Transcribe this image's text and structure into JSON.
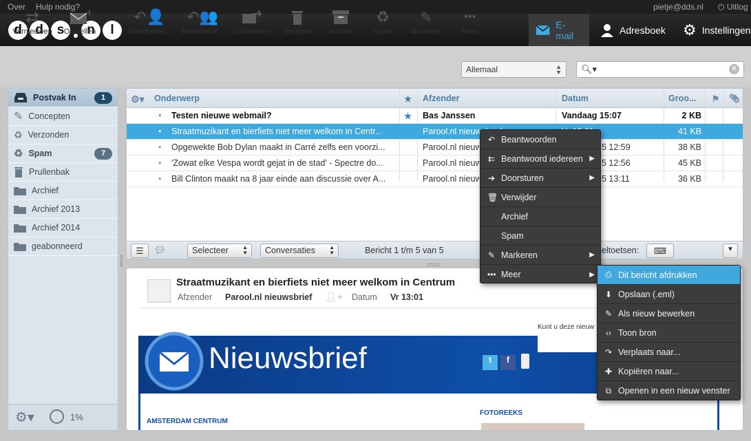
{
  "topstrip": {
    "about": "Over",
    "help": "Hulp nodig?",
    "user": "pietje@dds.nl",
    "logout": "Uitlog"
  },
  "logo": {
    "letters": [
      "d",
      "d",
      "s",
      "n",
      "l"
    ]
  },
  "nav": {
    "email": "E-mail",
    "contacts": "Adresboek",
    "settings": "Instellingen"
  },
  "toolbar": {
    "refresh": "Vernieuwen",
    "compose": "Opstellen",
    "reply": "Beantwoor...",
    "reply_all": "Beantwoor...",
    "forward": "Doorsturen",
    "delete": "Verwijder",
    "archive": "Archief",
    "spam": "Spam",
    "mark": "Markeren",
    "more": "Meer",
    "filter_value": "Allemaal",
    "search_placeholder": ""
  },
  "sidebar": {
    "folders": [
      {
        "label": "Postvak In",
        "count": "1"
      },
      {
        "label": "Concepten"
      },
      {
        "label": "Verzonden"
      },
      {
        "label": "Spam",
        "count": "7"
      },
      {
        "label": "Prullenbak"
      },
      {
        "label": "Archief"
      },
      {
        "label": "Archief 2013"
      },
      {
        "label": "Archief 2014"
      },
      {
        "label": "geabonneerd"
      }
    ],
    "quota": "1%"
  },
  "list": {
    "columns": {
      "subject": "Onderwerp",
      "from": "Afzender",
      "date": "Datum",
      "size": "Groo..."
    },
    "rows": [
      {
        "subject": "Testen nieuwe webmail?",
        "from": "Bas Janssen",
        "date": "Vandaag 15:07",
        "size": "2 KB"
      },
      {
        "subject": "Straatmuzikant en bierfiets niet meer welkom in Centr...",
        "from": "Parool.nl nieuwsbrief",
        "date": "Vr 13:01",
        "size": "41 KB"
      },
      {
        "subject": "Opgewekte Bob Dylan maakt in Carré zelfs een voorzi...",
        "from": "Parool.nl nieuwsbrief",
        "date": "5 12:59",
        "size": "38 KB"
      },
      {
        "subject": "'Zowat elke Vespa wordt gejat in de stad' - Spectre do...",
        "from": "Parool.nl nieuwsbrief",
        "date": "5 12:56",
        "size": "45 KB"
      },
      {
        "subject": "Bill Clinton maakt na 8 jaar einde aan discussie over A...",
        "from": "Parool.nl nieuwsbrief",
        "date": "5 13:11",
        "size": "36 KB"
      }
    ],
    "footer": {
      "select": "Selecteer",
      "threads": "Conversaties",
      "count": "Bericht 1 t/m 5 van 5",
      "shortcuts": "eltoetsen:"
    }
  },
  "preview": {
    "subject": "Straatmuzikant en bierfiets niet meer welkom in Centrum",
    "from_label": "Afzender",
    "from": "Parool.nl nieuwsbrief",
    "date_label": "Datum",
    "date": "Vr 13:01",
    "view_online": "Kunt u deze nieuw",
    "banner_title": "Nieuwsbrief",
    "section_left": "AMSTERDAM CENTRUM",
    "section_right": "FOTOREEKS"
  },
  "context_menu": [
    {
      "label": "Beantwoorden",
      "icon": "reply-icon"
    },
    {
      "label": "Beantwoord iedereen",
      "icon": "reply-all-icon",
      "submenu": true
    },
    {
      "label": "Doorsturen",
      "icon": "forward-icon",
      "submenu": true
    },
    {
      "label": "Verwijder",
      "icon": "trash-icon"
    },
    {
      "label": "Archief"
    },
    {
      "label": "Spam"
    },
    {
      "label": "Markeren",
      "icon": "pencil-icon",
      "submenu": true
    },
    {
      "label": "Meer",
      "icon": "dots-icon",
      "submenu": true
    }
  ],
  "submenu": [
    {
      "label": "Dit bericht afdrukken",
      "icon": "print-icon"
    },
    {
      "label": "Opslaan (.eml)",
      "icon": "download-icon"
    },
    {
      "label": "Als nieuw bewerken",
      "icon": "pencil-icon"
    },
    {
      "label": "Toon bron",
      "icon": "code-icon"
    },
    {
      "label": "Verplaats naar...",
      "icon": "move-icon"
    },
    {
      "label": "Kopiëren naar...",
      "icon": "copy-icon"
    },
    {
      "label": "Openen in een nieuw venster",
      "icon": "new-window-icon"
    }
  ],
  "colors": {
    "accent": "#3fa9de",
    "topbar": "#1f1f1f",
    "menu": "#3c3c3c",
    "banner": "#0f4fa8"
  }
}
